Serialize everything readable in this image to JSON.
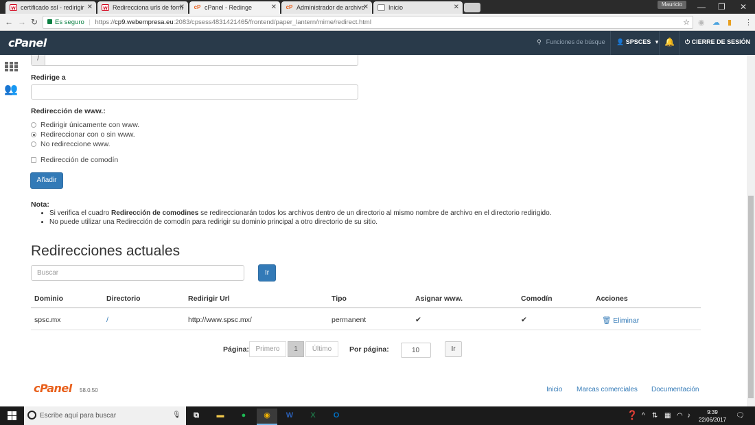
{
  "browser": {
    "tabs": [
      {
        "title": "certificado ssl - redirigir",
        "favicon": "w-icon"
      },
      {
        "title": "Redirecciona urls de form",
        "favicon": "w-icon"
      },
      {
        "title": "cPanel - Redinge",
        "favicon": "cpanel-icon"
      },
      {
        "title": "Administrador de archivo",
        "favicon": "cpanel-icon"
      },
      {
        "title": "Inicio",
        "favicon": "page-icon"
      }
    ],
    "profile": "Mauricio",
    "secure_label": "Es seguro",
    "url_prefix": "https://",
    "url_host": "cp9.webempresa.eu",
    "url_rest": ":2083/cpsess4831421465/frontend/paper_lantern/mime/redirect.html"
  },
  "header": {
    "logo": "cPanel",
    "search_placeholder": "Funciones de búsque",
    "user": "SPSCES",
    "logout": "CIERRE DE SESIÓN"
  },
  "form": {
    "dir_prefix": "/",
    "redirect_to_label": "Redirige a",
    "www_label": "Redirección de www.:",
    "www_options": [
      {
        "label": "Redirigir únicamente con www.",
        "selected": false
      },
      {
        "label": "Redireccionar con o sin www.",
        "selected": true
      },
      {
        "label": "No redireccione www.",
        "selected": false
      }
    ],
    "wildcard_label": "Redirección de comodín",
    "add_button": "Añadir"
  },
  "note": {
    "title": "Nota:",
    "item1_pre": "Si verifica el cuadro ",
    "item1_bold": "Redirección de comodines",
    "item1_post": " se redireccionarán todos los archivos dentro de un directorio al mismo nombre de archivo en el directorio redirigido.",
    "item2": "No puede utilizar una Redirección de comodín para redirigir su dominio principal a otro directorio de su sitio."
  },
  "current": {
    "title": "Redirecciones actuales",
    "search_placeholder": "Buscar",
    "go_button": "Ir",
    "columns": [
      "Dominio",
      "Directorio",
      "Redirigir Url",
      "Tipo",
      "Asignar www.",
      "Comodín",
      "Acciones"
    ],
    "rows": [
      {
        "domain": "spsc.mx",
        "directory": "/",
        "url": "http://www.spsc.mx/",
        "type": "permanent",
        "www": "✔",
        "wildcard": "✔",
        "action": "Eliminar"
      }
    ]
  },
  "pagination": {
    "page_label": "Página:",
    "first": "Primero",
    "current": "1",
    "last": "Último",
    "per_page_label": "Por página:",
    "per_page_value": "10",
    "go": "Ir"
  },
  "footer": {
    "logo": "cPanel",
    "version": "58.0.50",
    "links": [
      "Inicio",
      "Marcas comerciales",
      "Documentación"
    ]
  },
  "taskbar": {
    "search_placeholder": "Escribe aquí para buscar",
    "time": "9:39",
    "date": "22/06/2017"
  },
  "colors": {
    "header_bg": "#293a4a",
    "primary": "#337ab7",
    "cpanel_orange": "#e8601c"
  }
}
